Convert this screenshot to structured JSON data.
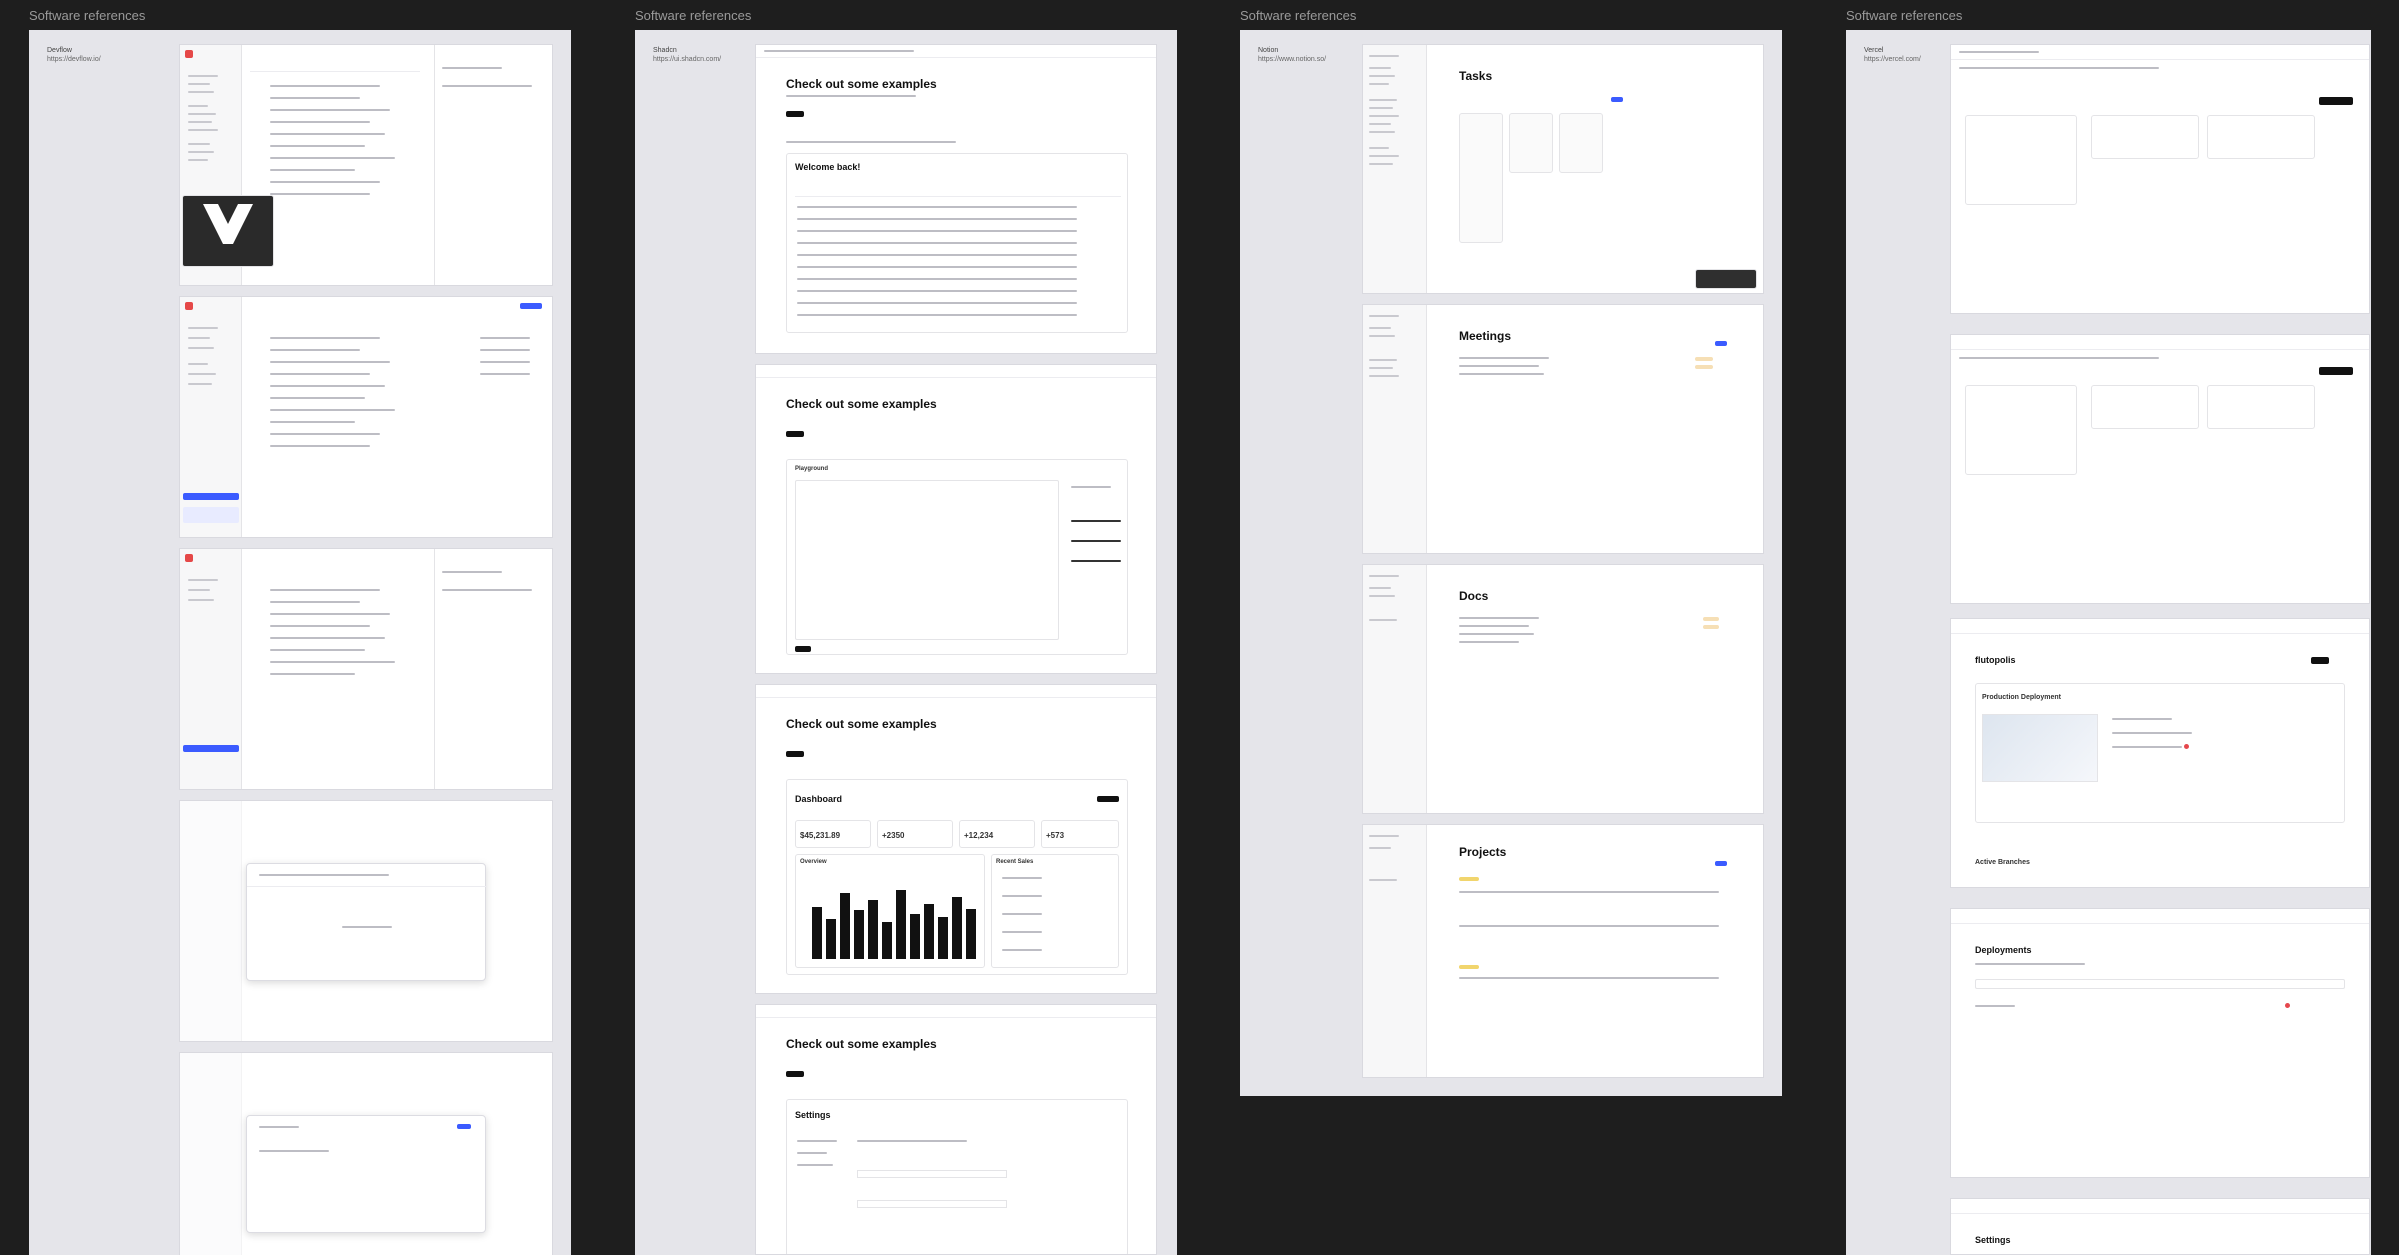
{
  "panels": [
    {
      "section": "Software references",
      "name": "Devflow",
      "url": "https://devflow.io/"
    },
    {
      "section": "Software references",
      "name": "Shadcn",
      "url": "https://ui.shadcn.com/"
    },
    {
      "section": "Software references",
      "name": "Notion",
      "url": "https://www.notion.so/"
    },
    {
      "section": "Software references",
      "name": "Vercel",
      "url": "https://vercel.com/"
    }
  ],
  "shadcn": {
    "heading": "Check out some examples",
    "welcome": "Welcome back!",
    "playground": "Playground",
    "dashboard": "Dashboard",
    "total_revenue": "$45,231.89",
    "subscriptions": "+2350",
    "sales": "+12,234",
    "active_now": "+573",
    "overview": "Overview",
    "recent_sales": "Recent Sales",
    "settings": "Settings",
    "chart_heights": [
      0.62,
      0.48,
      0.78,
      0.58,
      0.7,
      0.44,
      0.82,
      0.54,
      0.66,
      0.5,
      0.74,
      0.6
    ]
  },
  "notion": {
    "tasks": "Tasks",
    "meetings": "Meetings",
    "docs": "Docs",
    "projects": "Projects"
  },
  "vercel": {
    "project": "flutopolis",
    "production": "Production Deployment",
    "active_branches": "Active Branches",
    "deployments": "Deployments",
    "settings": "Settings"
  },
  "colors": {
    "background": "#1e1e1e",
    "panel": "#e5e5ea",
    "accent_blue": "#3b5bff",
    "dark_button": "#111111"
  }
}
